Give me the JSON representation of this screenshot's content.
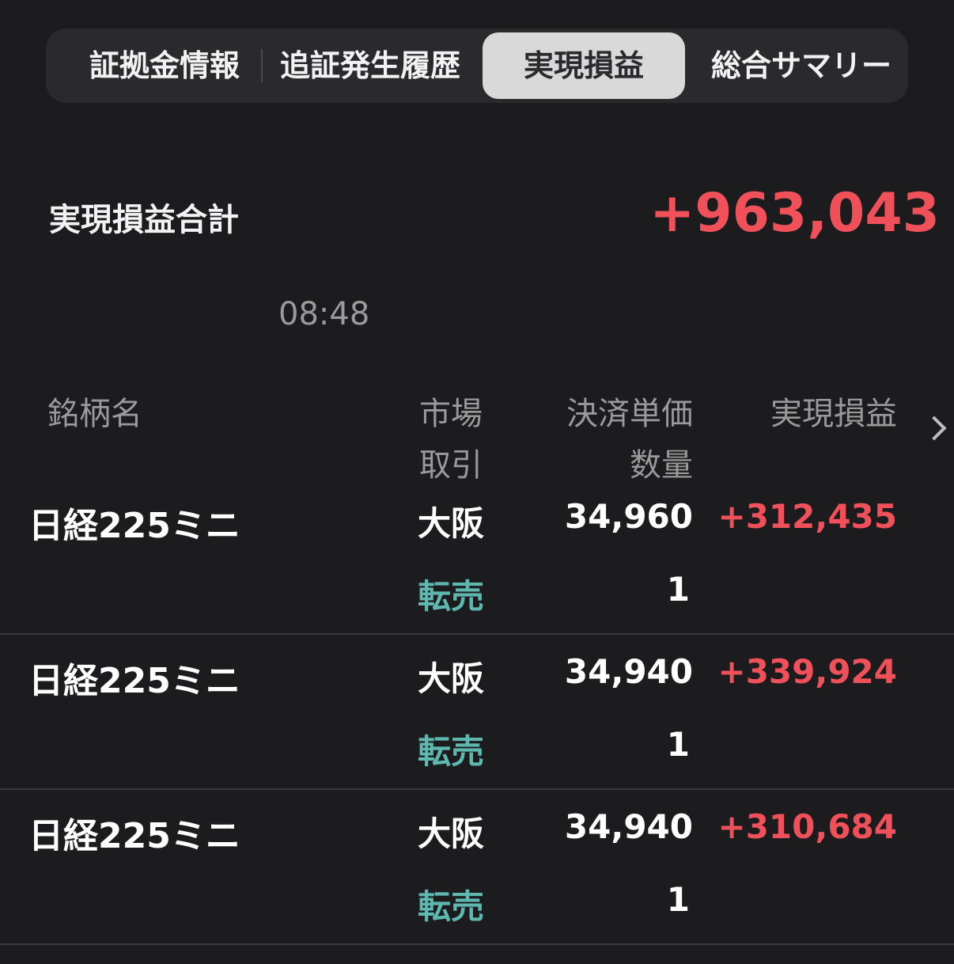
{
  "tabs": [
    {
      "label": "証拠金情報"
    },
    {
      "label": "追証発生履歴"
    },
    {
      "label": "実現損益"
    },
    {
      "label": "総合サマリー"
    }
  ],
  "summary": {
    "label": "実現損益合計",
    "value": "+963,043",
    "time": "08:48"
  },
  "columns": {
    "name": "銘柄名",
    "market": "市場",
    "trade": "取引",
    "price": "決済単価",
    "qty": "数量",
    "pnl": "実現損益"
  },
  "rows": [
    {
      "name": "日経225ミニ",
      "market": "大阪",
      "trade": "転売",
      "price": "34,960",
      "qty": "1",
      "pnl": "+312,435"
    },
    {
      "name": "日経225ミニ",
      "market": "大阪",
      "trade": "転売",
      "price": "34,940",
      "qty": "1",
      "pnl": "+339,924"
    },
    {
      "name": "日経225ミニ",
      "market": "大阪",
      "trade": "転売",
      "price": "34,940",
      "qty": "1",
      "pnl": "+310,684"
    }
  ],
  "colors": {
    "background": "#1c1c1e",
    "positive": "#f0505a",
    "trade": "#5fb8b0"
  }
}
